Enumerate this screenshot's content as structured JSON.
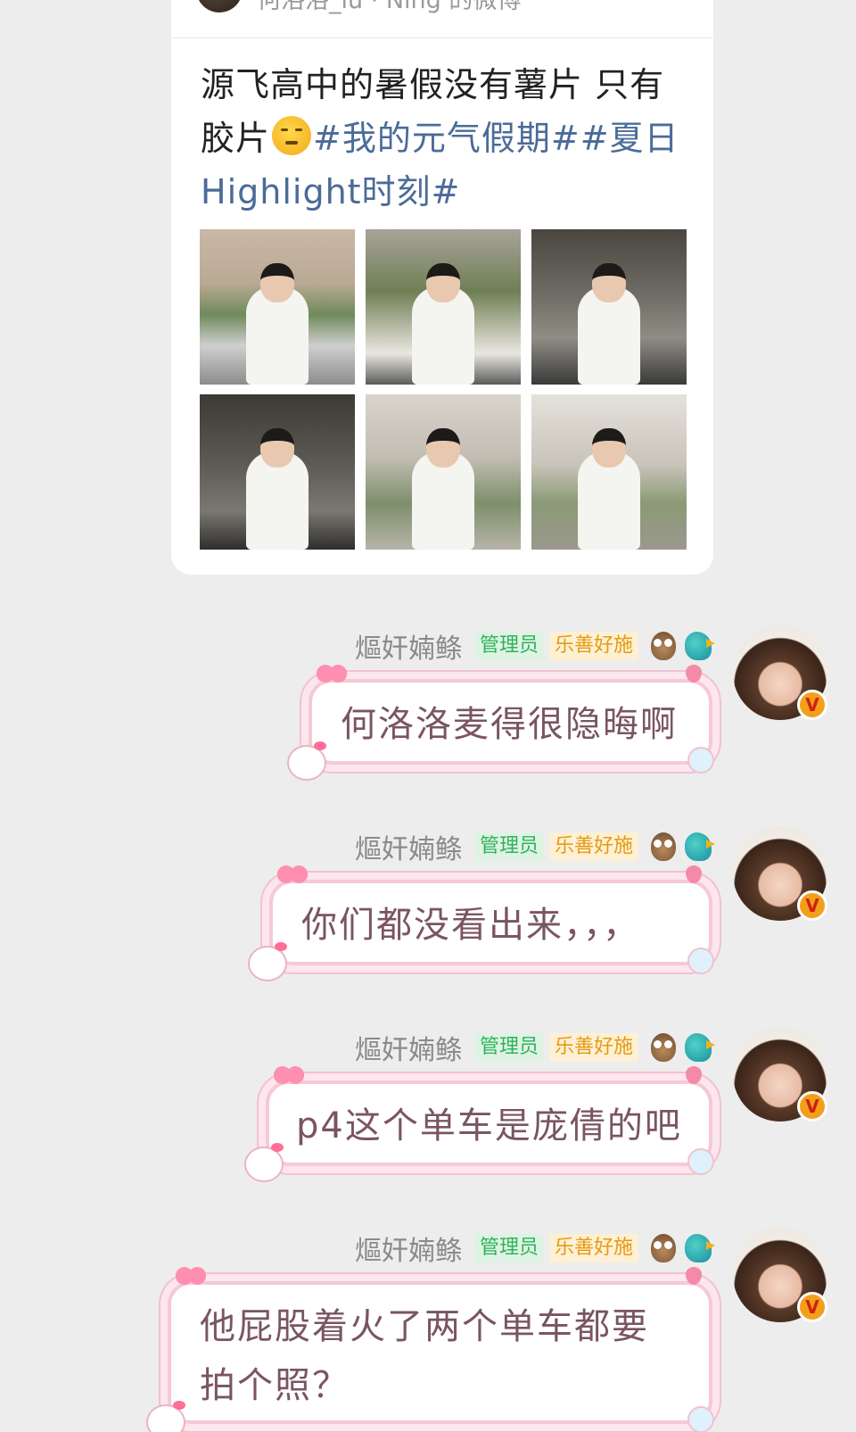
{
  "shared_post": {
    "source": "何洛洛_iu · Ning 的微博",
    "text_plain": "源飞高中的暑假没有薯片 只有胶片",
    "topics": [
      "#我的元气假期#",
      "#夏日Highlight时刻#"
    ],
    "photo_count": 6
  },
  "messages": [
    {
      "sender": "熰奸婻鲦",
      "badges": {
        "admin": "管理员",
        "donor": "乐善好施"
      },
      "text": "何洛洛麦得很隐晦啊"
    },
    {
      "sender": "熰奸婻鲦",
      "badges": {
        "admin": "管理员",
        "donor": "乐善好施"
      },
      "text": "你们都没看出来，，，"
    },
    {
      "sender": "熰奸婻鲦",
      "badges": {
        "admin": "管理员",
        "donor": "乐善好施"
      },
      "text": "p4这个单车是庞倩的吧"
    },
    {
      "sender": "熰奸婻鲦",
      "badges": {
        "admin": "管理员",
        "donor": "乐善好施"
      },
      "text_lines": [
        "他屁股着火了两个单车都要",
        "拍个照？"
      ]
    }
  ],
  "vip_mark": "V"
}
